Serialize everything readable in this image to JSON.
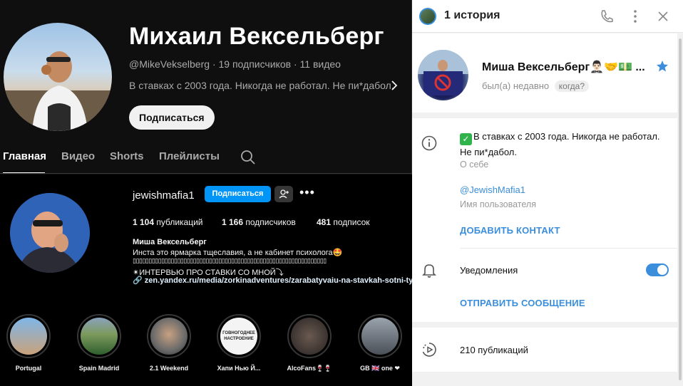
{
  "youtube": {
    "channel_name": "Михаил Вексельберг",
    "handle": "@MikeVekselberg",
    "separator": "·",
    "subscribers": "19 подписчиков",
    "videos": "11 видео",
    "description": "В ставках с 2003 года. Никогда не работал. Не пи*дабол.",
    "subscribe_label": "Подписаться",
    "tabs": [
      "Главная",
      "Видео",
      "Shorts",
      "Плейлисты"
    ],
    "active_tab": "Главная"
  },
  "instagram": {
    "username": "jewishmafia1",
    "follow_label": "Подписаться",
    "more_label": "•••",
    "stats": {
      "posts_count": "1 104",
      "posts_label": "публикаций",
      "followers_count": "1 166",
      "followers_label": "подписчиков",
      "following_count": "481",
      "following_label": "подписок"
    },
    "bio": {
      "name": "Миша Вексельберг",
      "line1": "Инста это ярмарка тщеславия, а не кабинет психолога🤩",
      "line2": "▯▯▯▯▯▯▯▯▯▯▯▯▯▯▯▯▯▯▯▯▯▯▯▯▯▯▯▯▯▯▯▯▯▯▯▯▯▯▯▯▯▯▯▯▯▯▯▯▯▯▯▯▯▯▯▯▯▯▯▯▯",
      "line3": "✴ИНТЕРВЬЮ ПРО СТАВКИ СО МНОЙ⤵",
      "link": "zen.yandex.ru/media/zorkinadventures/zarabatyvaiu-na-stavkah-sotni-tysiach-v"
    },
    "highlights": [
      {
        "label": "Portugal",
        "colors": [
          "#7fb6e8",
          "#c9a27a"
        ]
      },
      {
        "label": "Spain Madrid",
        "colors": [
          "#7c9a5c",
          "#2f5e2f"
        ]
      },
      {
        "label": "2.1 Weekend",
        "colors": [
          "#6a6a6a",
          "#c7a182"
        ]
      },
      {
        "label": "Хапи Нью Й...",
        "colors": [
          "#ffffff",
          "#f2f2f2"
        ],
        "inner_text": "ГОВНОГОДНЕЕ НАСТРОЕНИЕ"
      },
      {
        "label": "AlcoFans🍷🍷",
        "colors": [
          "#3b3330",
          "#6a5a50"
        ]
      },
      {
        "label": "GB 🇬🇧 one ❤",
        "colors": [
          "#9aa3ad",
          "#4b5058"
        ]
      }
    ]
  },
  "telegram": {
    "header_title": "1 история",
    "profile_name": "Миша Вексельберг🤵🏻‍♂️🤝💵 ...",
    "status": "был(а) недавно",
    "when_chip": "когда?",
    "about_check": "✓",
    "about_text": "В ставках с 2003 года. Никогда не работал. Не пи*дабол.",
    "about_label": "О себе",
    "username": "@JewishMafia1",
    "username_label": "Имя пользователя",
    "add_contact": "ДОБАВИТЬ КОНТАКТ",
    "notifications_label": "Уведомления",
    "notifications_on": true,
    "send_message": "ОТПРАВИТЬ СООБЩЕНИЕ",
    "publications": "210 публикаций",
    "accent_color": "#3a8edb"
  }
}
